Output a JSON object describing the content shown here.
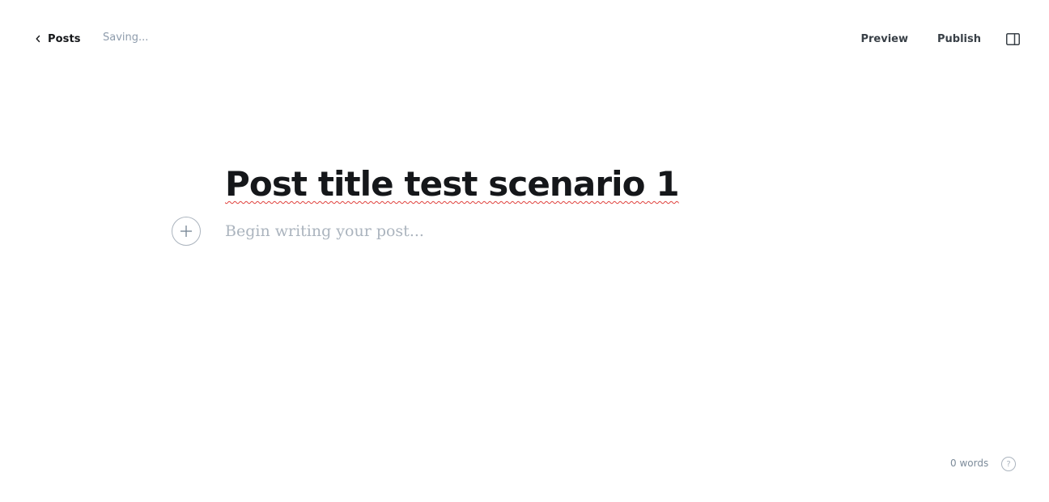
{
  "header": {
    "back_label": "Posts",
    "back_icon": "chevron-left-icon",
    "status": "Saving...",
    "preview_label": "Preview",
    "publish_label": "Publish",
    "sidebar_toggle_icon": "sidebar-toggle-icon"
  },
  "editor": {
    "title": "Post title test scenario 1",
    "body_placeholder": "Begin writing your post...",
    "add_card_icon": "plus-icon"
  },
  "footer": {
    "word_count": "0 words",
    "help_icon": "question-mark-icon",
    "help_glyph": "?"
  },
  "colors": {
    "text_primary": "#15171a",
    "text_muted": "#8e9cac",
    "placeholder": "#abb4be",
    "spellcheck_underline": "#e0403b",
    "background": "#ffffff"
  }
}
